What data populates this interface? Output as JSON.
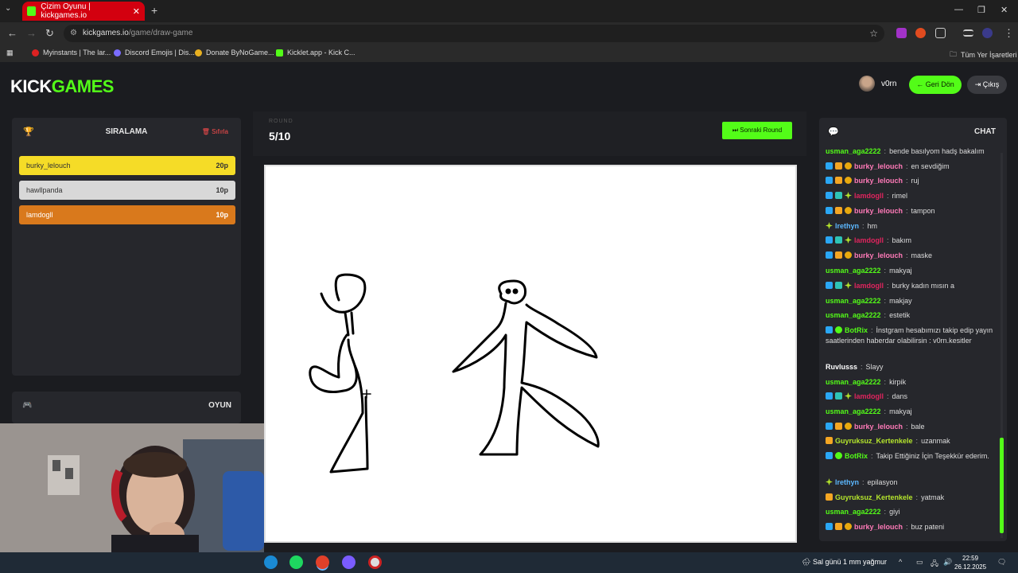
{
  "browser": {
    "tab_title": "Çizim Oyunu | kickgames.io",
    "url_host": "kickgames.io",
    "url_path": "/game/draw-game",
    "bookmarks": [
      "Myinstants | The lar...",
      "Discord Emojis | Dis...",
      "Donate ByNoGame...",
      "Kicklet.app - Kick C..."
    ],
    "bookmarks_folder": "Tüm Yer İşaretleri"
  },
  "site": {
    "logo_a": "KICK",
    "logo_b": "GAMES",
    "username": "v0rn",
    "back_label": "Geri Dön",
    "exit_label": "Çıkış"
  },
  "ranking": {
    "title": "SIRALAMA",
    "reset_label": "Sıfırla",
    "rows": [
      {
        "name": "burky_lelouch",
        "points": "20p",
        "color": "#f5dc27"
      },
      {
        "name": "hawllpanda",
        "points": "10p",
        "color": "#d8d8d8"
      },
      {
        "name": "lamdogll",
        "points": "10p",
        "color": "#d9791c"
      }
    ]
  },
  "game_panel": {
    "title": "OYUN"
  },
  "round": {
    "label": "ROUND",
    "value": "5/10",
    "next_label": "Sonraki Round"
  },
  "chat": {
    "title": "CHAT",
    "messages": [
      {
        "user": "usman_aga2222",
        "color": "#53fc18",
        "badges": [],
        "text": "bende basılyom hadş bakalım"
      },
      {
        "user": "burky_lelouch",
        "color": "#ff7ab8",
        "badges": [
          "s",
          "c",
          "o"
        ],
        "text": "en sevdiğim"
      },
      {
        "user": "burky_lelouch",
        "color": "#ff7ab8",
        "badges": [
          "s",
          "c",
          "o"
        ],
        "text": "ruj"
      },
      {
        "user": "lamdogll",
        "color": "#e0245e",
        "badges": [
          "s",
          "g",
          "st"
        ],
        "text": "rimel"
      },
      {
        "user": "burky_lelouch",
        "color": "#ff7ab8",
        "badges": [
          "s",
          "c",
          "o"
        ],
        "text": "tampon"
      },
      {
        "user": "lrethyn",
        "color": "#5cb8ff",
        "badges": [
          "st"
        ],
        "text": "hm"
      },
      {
        "user": "lamdogll",
        "color": "#e0245e",
        "badges": [
          "s",
          "g",
          "st"
        ],
        "text": "bakım"
      },
      {
        "user": "burky_lelouch",
        "color": "#ff7ab8",
        "badges": [
          "s",
          "c",
          "o"
        ],
        "text": "maske"
      },
      {
        "user": "usman_aga2222",
        "color": "#53fc18",
        "badges": [],
        "text": "makyaj"
      },
      {
        "user": "lamdogll",
        "color": "#e0245e",
        "badges": [
          "s",
          "g",
          "st"
        ],
        "text": "burky kadın mısın a"
      },
      {
        "user": "usman_aga2222",
        "color": "#53fc18",
        "badges": [],
        "text": "makjay"
      },
      {
        "user": "usman_aga2222",
        "color": "#53fc18",
        "badges": [],
        "text": "estetik"
      },
      {
        "user": "BotRix",
        "color": "#53fc18",
        "badges": [
          "s",
          "v"
        ],
        "text": "İnstgram hesabımızı takip edip yayın saatlerinden haberdar olabilirsin : v0rn.kesitler"
      },
      {
        "user": "Ruvlusss",
        "color": "#ffffff",
        "badges": [],
        "text": "Slayy"
      },
      {
        "user": "usman_aga2222",
        "color": "#53fc18",
        "badges": [],
        "text": "kirpik"
      },
      {
        "user": "lamdogll",
        "color": "#e0245e",
        "badges": [
          "s",
          "g",
          "st"
        ],
        "text": "dans"
      },
      {
        "user": "usman_aga2222",
        "color": "#53fc18",
        "badges": [],
        "text": "makyaj"
      },
      {
        "user": "burky_lelouch",
        "color": "#ff7ab8",
        "badges": [
          "s",
          "c",
          "o"
        ],
        "text": "bale"
      },
      {
        "user": "Guyruksuz_Kertenkele",
        "color": "#b5e62c",
        "badges": [
          "c"
        ],
        "text": "uzanmak"
      },
      {
        "user": "BotRix",
        "color": "#53fc18",
        "badges": [
          "s",
          "v"
        ],
        "text": "Takip Ettiğiniz İçin Teşekkür ederim."
      },
      {
        "user": "lrethyn",
        "color": "#5cb8ff",
        "badges": [
          "st"
        ],
        "text": "epilasyon"
      },
      {
        "user": "Guyruksuz_Kertenkele",
        "color": "#b5e62c",
        "badges": [
          "c"
        ],
        "text": "yatmak"
      },
      {
        "user": "usman_aga2222",
        "color": "#53fc18",
        "badges": [],
        "text": "giyi"
      },
      {
        "user": "burky_lelouch",
        "color": "#ff7ab8",
        "badges": [
          "s",
          "c",
          "o"
        ],
        "text": "buz pateni"
      }
    ]
  },
  "taskbar": {
    "weather": "Sal günü 1 mm yağmur",
    "time": "22:59",
    "date": "26.12.2025"
  },
  "colors": {
    "accent": "#53fc18",
    "reset": "#ff4d4d"
  }
}
